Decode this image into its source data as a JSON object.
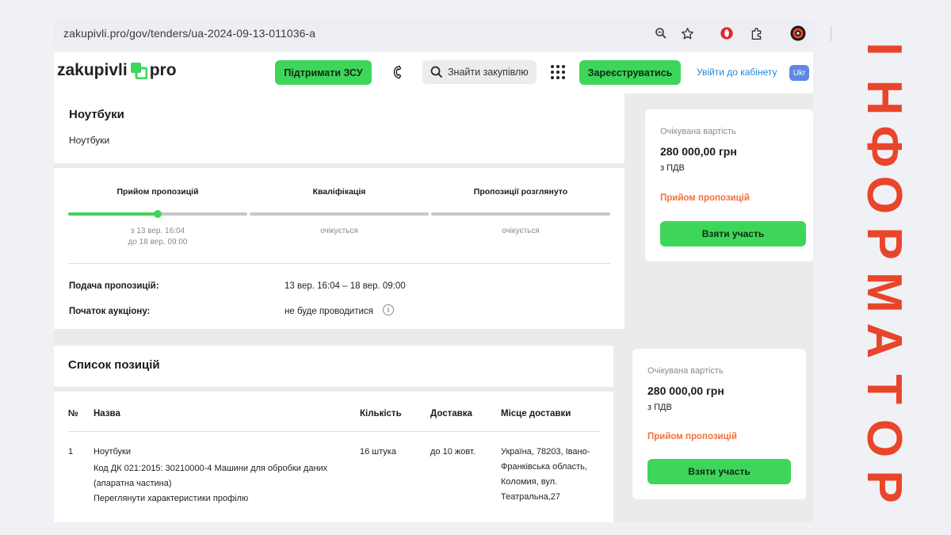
{
  "browser": {
    "url": "zakupivli.pro/gov/tenders/ua-2024-09-13-011036-a",
    "icons": [
      "zoom-icon",
      "star-icon",
      "opera-icon",
      "extensions-icon",
      "profile-icon"
    ]
  },
  "nav": {
    "logo_left": "zakupivli",
    "logo_right": "pro",
    "support_button": "Підтримати ЗСУ",
    "search_placeholder": "Знайти закупівлю",
    "register_button": "Зареєструватись",
    "login_link": "Увійти до кабінету",
    "lang": "Ukr"
  },
  "tender": {
    "title": "Ноутбуки",
    "description": "Ноутбуки"
  },
  "stages": [
    {
      "label": "Прийом пропозицій",
      "line1": "з 13 вер. 16:04",
      "line2": "до 18 вер. 09:00",
      "progress": 0.5
    },
    {
      "label": "Кваліфікація",
      "line1": "очікується",
      "line2": "",
      "progress": 0
    },
    {
      "label": "Пропозиції розглянуто",
      "line1": "очікується",
      "line2": "",
      "progress": 0
    }
  ],
  "details": {
    "submission_label": "Подача пропозицій:",
    "submission_value": "13 вер. 16:04 – 18 вер. 09:00",
    "auction_label": "Початок аукціону:",
    "auction_value": "не буде проводитися"
  },
  "price_card": {
    "expected_label": "Очікувана вартість",
    "amount": "280 000,00 грн",
    "vat": "з ПДВ",
    "status": "Прийом пропозицій",
    "participate_button": "Взяти участь"
  },
  "positions": {
    "heading": "Список позицій",
    "columns": [
      "№",
      "Назва",
      "Кількість",
      "Доставка",
      "Місце доставки"
    ],
    "rows": [
      {
        "num": "1",
        "name": "Ноутбуки",
        "code": "Код ДК 021:2015: 30210000-4 Машини для обробки даних (апаратна частина)",
        "profile_link": "Переглянути характеристики профілю",
        "quantity": "16 штука",
        "delivery": "до 10 жовт.",
        "place": "Україна, 78203, Івано-Франківська область, Коломия, вул. Театральна,27"
      }
    ]
  },
  "watermark": {
    "text": "ІНФОРМАТОР",
    "color": "#e8452b"
  },
  "colors": {
    "accent_green": "#3ed65a",
    "status_orange": "#f07138",
    "link_blue": "#1e88d6"
  }
}
